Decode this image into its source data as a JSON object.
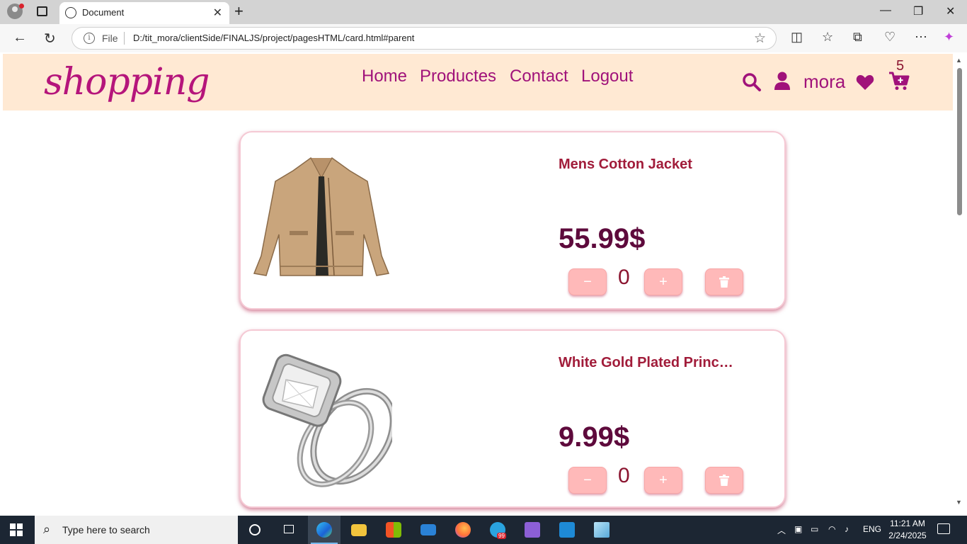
{
  "browser": {
    "tab_title": "Document",
    "url_scheme_label": "File",
    "url": "D:/tit_mora/clientSide/FINALJS/project/pagesHTML/card.html#parent"
  },
  "site": {
    "logo": "shopping",
    "nav": [
      {
        "label": "Home"
      },
      {
        "label": "Productes"
      },
      {
        "label": "Contact"
      },
      {
        "label": "Logout"
      }
    ],
    "user_name": "mora",
    "cart_count": "5",
    "accent_color": "#a0127a"
  },
  "cart_items": [
    {
      "title": "Mens Cotton Jacket",
      "price": "55.99$",
      "quantity": "0",
      "minus": "−",
      "plus": "+",
      "image": "jacket"
    },
    {
      "title": "White Gold Plated Princ…",
      "price": "9.99$",
      "quantity": "0",
      "minus": "−",
      "plus": "+",
      "image": "ring"
    }
  ],
  "taskbar": {
    "search_placeholder": "Type here to search",
    "language": "ENG",
    "time": "11:21 AM",
    "date": "2/24/2025",
    "telegram_badge": "99"
  }
}
